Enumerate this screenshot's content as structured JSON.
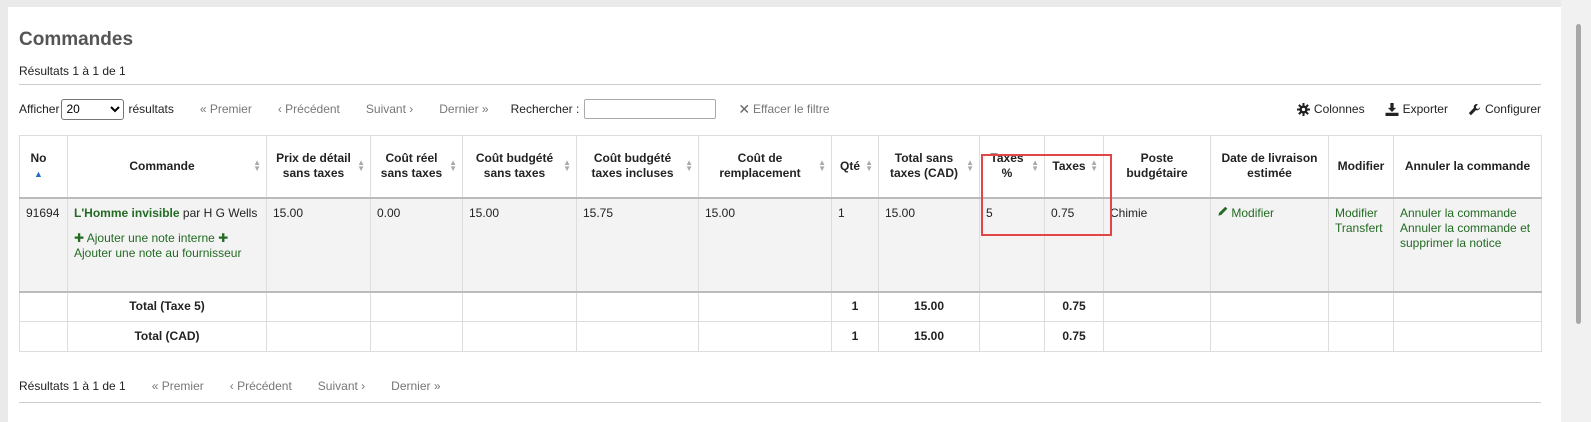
{
  "page": {
    "title": "Commandes",
    "results_top": "Résultats 1 à 1 de 1",
    "results_bottom": "Résultats 1 à 1 de 1"
  },
  "toolbar": {
    "show_label": "Afficher",
    "page_size": "20",
    "results_label": "résultats",
    "first": "« Premier",
    "previous": "‹ Précédent",
    "next": "Suivant ›",
    "last": "Dernier »",
    "search_label": "Rechercher :",
    "search_value": "",
    "clear_filter": "Effacer le filtre",
    "columns": "Colonnes",
    "export": "Exporter",
    "configure": "Configurer"
  },
  "table": {
    "headers": {
      "no": "No",
      "order": "Commande",
      "retail_price": "Prix de détail sans taxes",
      "actual_cost": "Coût réel sans taxes",
      "budgeted_cost": "Coût budgété sans taxes",
      "budgeted_cost_tax": "Coût budgété taxes incluses",
      "replacement_cost": "Coût de remplacement",
      "qty": "Qté",
      "total_excl": "Total sans taxes (CAD)",
      "tax_pct": "Taxes %",
      "tax": "Taxes",
      "fund": "Poste budgétaire",
      "est_delivery": "Date de livraison estimée",
      "modify": "Modifier",
      "cancel": "Annuler la commande"
    },
    "row": {
      "no": "91694",
      "title": "L'Homme invisible",
      "by": "par H G Wells",
      "add_internal_note": "Ajouter une note interne",
      "add_vendor_note": "Ajouter une note au fournisseur",
      "retail_price": "15.00",
      "actual_cost": "0.00",
      "budgeted_cost": "15.00",
      "budgeted_cost_tax": "15.75",
      "replacement_cost": "15.00",
      "qty": "1",
      "total_excl": "15.00",
      "tax_pct": "5",
      "tax": "0.75",
      "fund": "Chimie",
      "est_delivery_link": "Modifier",
      "modify_link": "Modifier",
      "transfer_link": "Transfert",
      "cancel_link": "Annuler la commande",
      "cancel_delete_link": "Annuler la commande et supprimer la notice"
    },
    "totals": [
      {
        "label": "Total (Taxe 5)",
        "qty": "1",
        "total": "15.00",
        "tax": "0.75"
      },
      {
        "label": "Total (CAD)",
        "qty": "1",
        "total": "15.00",
        "tax": "0.75"
      }
    ]
  },
  "colors": {
    "link_green": "#236a23",
    "highlight_red": "#e24545"
  }
}
